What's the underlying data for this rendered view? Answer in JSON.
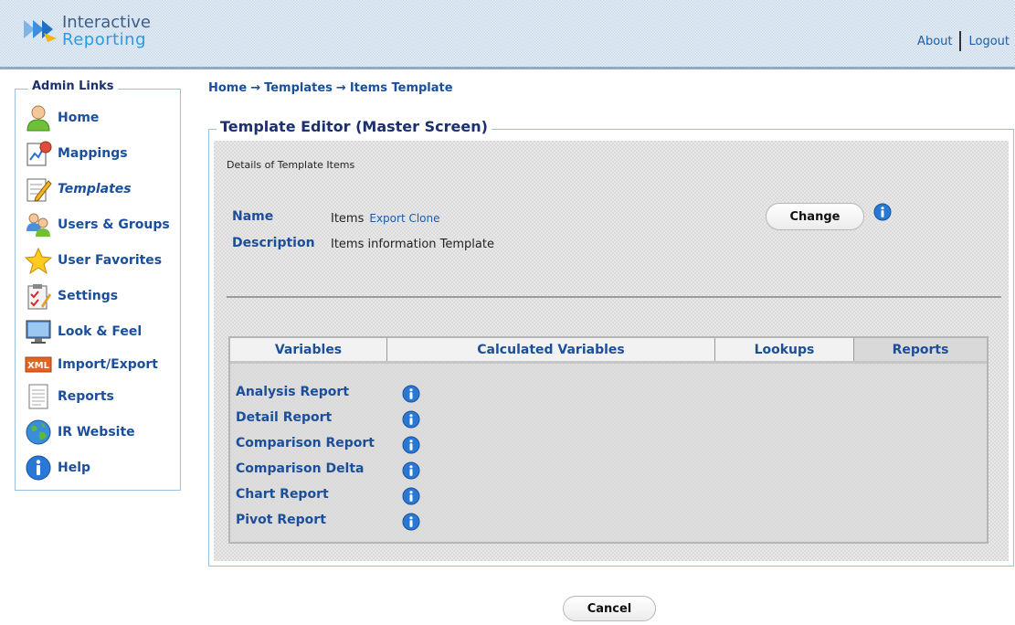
{
  "app": {
    "logo_line1": "Interactive",
    "logo_line2": "Reporting",
    "about": "About",
    "logout": "Logout"
  },
  "sidebar": {
    "title": "Admin Links",
    "items": [
      {
        "label": "Home",
        "icon": "user-icon"
      },
      {
        "label": "Mappings",
        "icon": "mappings-chart-icon"
      },
      {
        "label": "Templates",
        "icon": "pencil-document-icon"
      },
      {
        "label": "Users & Groups",
        "icon": "users-group-icon"
      },
      {
        "label": "User Favorites",
        "icon": "star-icon"
      },
      {
        "label": "Settings",
        "icon": "clipboard-settings-icon"
      },
      {
        "label": "Look & Feel",
        "icon": "monitor-icon"
      },
      {
        "label": "Import/Export",
        "icon": "xml-icon"
      },
      {
        "label": "Reports",
        "icon": "report-document-icon"
      },
      {
        "label": "IR Website",
        "icon": "globe-icon"
      },
      {
        "label": "Help",
        "icon": "info-icon"
      }
    ],
    "active": "Templates"
  },
  "breadcrumb": {
    "home": "Home",
    "templates": "Templates",
    "current": "Items Template",
    "arrow": "→"
  },
  "editor": {
    "title": "Template Editor (Master Screen)",
    "details": "Details of Template Items",
    "name_label": "Name",
    "name_value": "Items",
    "export_clone": "Export Clone",
    "description_label": "Description",
    "description_value": "Items information  Template",
    "change_button": "Change"
  },
  "tabs": [
    {
      "label": "Variables"
    },
    {
      "label": "Calculated Variables"
    },
    {
      "label": "Lookups"
    },
    {
      "label": "Reports"
    }
  ],
  "selected_tab": "Reports",
  "reports": [
    "Analysis Report",
    "Detail Report",
    "Comparison Report",
    "Comparison Delta",
    "Chart Report",
    "Pivot Report"
  ],
  "footer": {
    "cancel_button": "Cancel"
  },
  "colors": {
    "link_blue": "#1b4f9b",
    "header_bg": "#c9daea",
    "panel_border": "#9cc0e0",
    "info_icon": "#2a78d6"
  }
}
